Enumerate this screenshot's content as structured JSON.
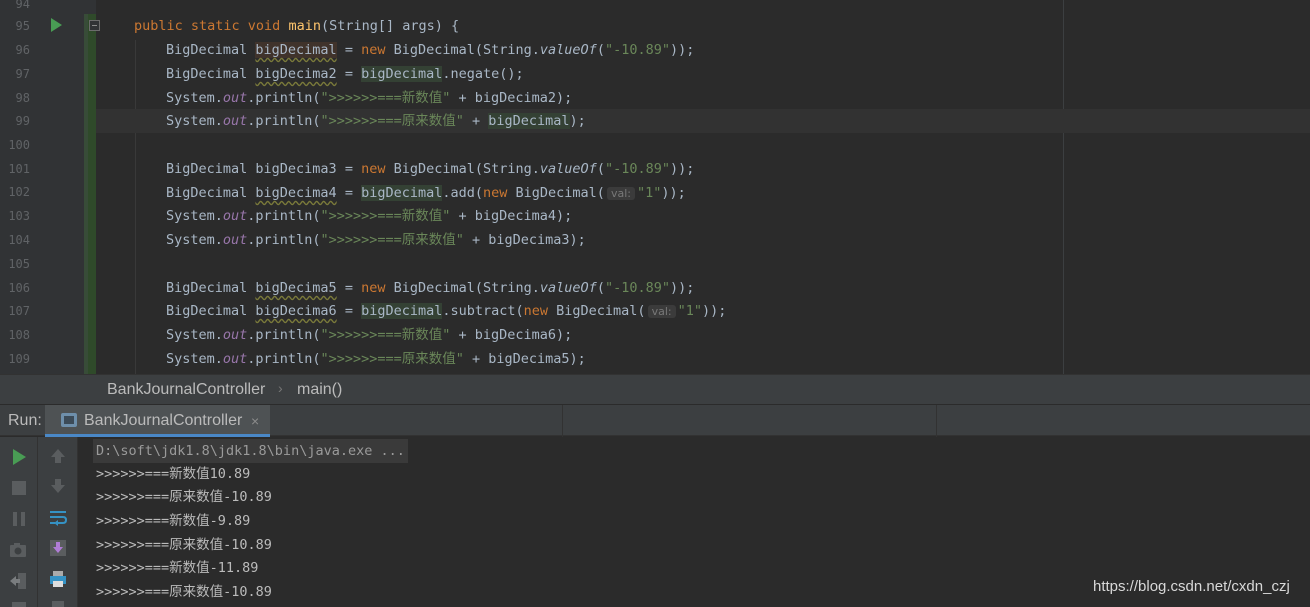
{
  "editor": {
    "line_numbers": [
      "94",
      "95",
      "96",
      "97",
      "98",
      "99",
      "100",
      "101",
      "102",
      "103",
      "104",
      "105",
      "106",
      "107",
      "108",
      "109"
    ],
    "lines": {
      "l95": {
        "kw1": "public static void ",
        "fn": "main",
        "rest": "(String[] args) {"
      },
      "l96": {
        "a": "BigDecimal ",
        "var": "bigDecimal",
        "b": " = ",
        "kw": "new",
        "c": " BigDecimal(String.",
        "m": "valueOf",
        "d": "(",
        "s": "\"-10.89\"",
        "e": "));"
      },
      "l97": {
        "a": "BigDecimal ",
        "var": "bigDecima2",
        "b": " = ",
        "ref": "bigDecimal",
        "c": ".negate();"
      },
      "l98": {
        "a": "System.",
        "f": "out",
        "b": ".println(",
        "s": "\">>>>>>===新数值\"",
        "c": " + bigDecima2);"
      },
      "l99": {
        "a": "System.",
        "f": "out",
        "b": ".println(",
        "s": "\">>>>>>===原来数值\"",
        "c": " + ",
        "ref": "bigDecimal",
        "d": ");"
      },
      "l101": {
        "a": "BigDecimal ",
        "var": "bigDecima3",
        "b": " = ",
        "kw": "new",
        "c": " BigDecimal(String.",
        "m": "valueOf",
        "d": "(",
        "s": "\"-10.89\"",
        "e": "));"
      },
      "l102": {
        "a": "BigDecimal ",
        "var": "bigDecima4",
        "b": " = ",
        "ref": "bigDecimal",
        "c": ".add(",
        "kw": "new",
        "d": " BigDecimal(",
        "hint": "val:",
        "s": "\"1\"",
        "e": "));"
      },
      "l103": {
        "a": "System.",
        "f": "out",
        "b": ".println(",
        "s": "\">>>>>>===新数值\"",
        "c": " + bigDecima4);"
      },
      "l104": {
        "a": "System.",
        "f": "out",
        "b": ".println(",
        "s": "\">>>>>>===原来数值\"",
        "c": " + bigDecima3);"
      },
      "l106": {
        "a": "BigDecimal ",
        "var": "bigDecima5",
        "b": " = ",
        "kw": "new",
        "c": " BigDecimal(String.",
        "m": "valueOf",
        "d": "(",
        "s": "\"-10.89\"",
        "e": "));"
      },
      "l107": {
        "a": "BigDecimal ",
        "var": "bigDecima6",
        "b": " = ",
        "ref": "bigDecimal",
        "c": ".subtract(",
        "kw": "new",
        "d": " BigDecimal(",
        "hint": "val:",
        "s": "\"1\"",
        "e": "));"
      },
      "l108": {
        "a": "System.",
        "f": "out",
        "b": ".println(",
        "s": "\">>>>>>===新数值\"",
        "c": " + bigDecima6);"
      },
      "l109": {
        "a": "System.",
        "f": "out",
        "b": ".println(",
        "s": "\">>>>>>===原来数值\"",
        "c": " + bigDecima5);"
      }
    }
  },
  "breadcrumb": {
    "class_name": "BankJournalController",
    "separator": "›",
    "method": "main()"
  },
  "run": {
    "label": "Run:",
    "tab_title": "BankJournalController",
    "tab_close": "×",
    "console": [
      "D:\\soft\\jdk1.8\\jdk1.8\\bin\\java.exe ...",
      ">>>>>>===新数值10.89",
      ">>>>>>===原来数值-10.89",
      ">>>>>>===新数值-9.89",
      ">>>>>>===原来数值-10.89",
      ">>>>>>===新数值-11.89",
      ">>>>>>===原来数值-10.89"
    ]
  },
  "toolbar_icons": [
    "rerun-icon",
    "stop-icon",
    "pause-icon",
    "camera-icon",
    "exit-icon",
    "up-arrow-icon",
    "down-arrow-icon",
    "soft-wrap-icon",
    "scroll-to-end-icon",
    "print-icon"
  ],
  "colors": {
    "background": "#2b2b2b",
    "keyword": "#cc7832",
    "string": "#6a8759",
    "function": "#ffc66d",
    "static_field": "#9876aa",
    "run_green": "#499c54",
    "tab_accent": "#4a88c7"
  },
  "watermark": "https://blog.csdn.net/cxdn_czj"
}
